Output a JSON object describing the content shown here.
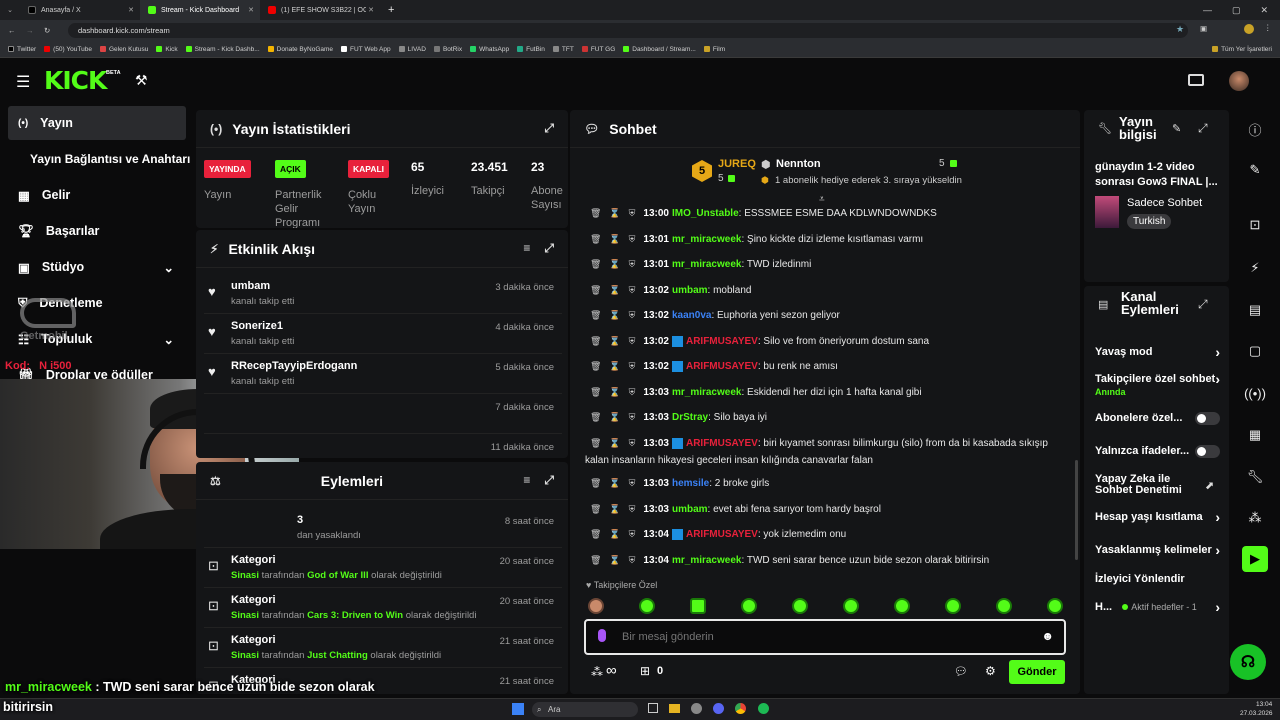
{
  "browser": {
    "tabs": [
      {
        "label": "Anasayfa / X"
      },
      {
        "label": "Stream - Kick Dashboard"
      },
      {
        "label": "(1) EFE SHOW S3B22 | OĞUZHA..."
      }
    ],
    "new_tab": "+",
    "url": "dashboard.kick.com/stream",
    "bookmarks": [
      "Twitter",
      "(50) YouTube",
      "Gelen Kutusu",
      "Kick",
      "Stream - Kick Dashb...",
      "Donate ByNoGame",
      "FUT Web App",
      "LIVAD",
      "BotRix",
      "WhatsApp",
      "FutBin",
      "TFT",
      "FUT GG",
      "Dashboard / Stream...",
      "Film"
    ],
    "bookmarks_right": "Tüm Yer İşaretleri"
  },
  "header": {
    "logo": "KICK",
    "beta": "BETA"
  },
  "sidebar": {
    "items": [
      {
        "label": "Yayın",
        "icon": "live-icon"
      },
      {
        "label": "Yayın Bağlantısı ve Anahtarı",
        "icon": ""
      },
      {
        "label": "Gelir",
        "icon": "revenue-icon"
      },
      {
        "label": "Başarılar",
        "icon": "trophy-icon"
      },
      {
        "label": "Stüdyo",
        "icon": "studio-icon"
      },
      {
        "label": "Denetleme",
        "icon": "shield-icon"
      },
      {
        "label": "Topluluk",
        "icon": "users-icon"
      },
      {
        "label": "Droplar ve ödüller",
        "icon": "gift-icon"
      }
    ]
  },
  "overlay": {
    "watermark": "Getmobil",
    "code_label": "Kod:",
    "code_value": "N   i500",
    "chat_line_user": "mr_miracweek",
    "chat_line_text": " : TWD seni sarar bence uzun bide sezon olarak",
    "chat_line_text2": "bitirirsin"
  },
  "stats": {
    "title": "Yayın İstatistikleri",
    "badges": [
      {
        "text": "YAYINDA",
        "label": "Yayın",
        "color": "#e8213b"
      },
      {
        "text": "AÇIK",
        "label": "Partnerlik Gelir Programı",
        "color": "#53fc18"
      },
      {
        "text": "KAPALI",
        "label": "Çoklu Yayın",
        "color": "#e8213b"
      }
    ],
    "numbers": [
      {
        "value": "65",
        "label": "İzleyici"
      },
      {
        "value": "23.451",
        "label": "Takipçi"
      },
      {
        "value": "23",
        "label": "Abone Sayısı"
      }
    ]
  },
  "activity": {
    "title": "Etkinlik Akışı",
    "items": [
      {
        "name": "umbam",
        "desc": "kanalı takip etti",
        "time": "3 dakika önce"
      },
      {
        "name": "Sonerize1",
        "desc": "kanalı takip etti",
        "time": "4 dakika önce"
      },
      {
        "name": "RRecepTayyipErdogann",
        "desc": "kanalı takip etti",
        "time": "5 dakika önce"
      },
      {
        "name": "",
        "desc": "",
        "time": "7 dakika önce"
      },
      {
        "name": "",
        "desc": "",
        "time": "11 dakika önce"
      }
    ]
  },
  "modactions": {
    "title": "Eylemleri",
    "items": [
      {
        "name": "3",
        "desc": "dan yasaklandı",
        "time": "8 saat önce"
      },
      {
        "name": "Kategori",
        "user": "Sinasi",
        "mid": " tarafından ",
        "game": "God of War III",
        "tail": " olarak değiştirildi",
        "time": "20 saat önce"
      },
      {
        "name": "Kategori",
        "user": "Sinasi",
        "mid": " tarafından ",
        "game": "Cars 3: Driven to Win",
        "tail": " olarak değiştirildi",
        "time": "20 saat önce"
      },
      {
        "name": "Kategori",
        "user": "Sinasi",
        "mid": " tarafından ",
        "game": "Just Chatting",
        "tail": " olarak değiştirildi",
        "time": "21 saat önce"
      },
      {
        "name": "Kategori",
        "time": "21 saat önce"
      }
    ]
  },
  "chat": {
    "title": "Sohbet",
    "pinned": {
      "user1": "JUREQ",
      "user1_count": "5",
      "user2": "Nennton",
      "user2_count": "5",
      "desc": "1 abonelik hediye ederek 3. sıraya yükseldin",
      "level": "5"
    },
    "messages": [
      {
        "time": "13:00",
        "user": "IMO_Unstable",
        "color": "#53fc18",
        "text": "ESSSMEE ESME DAA KDLWNDOWNDKS"
      },
      {
        "time": "13:01",
        "user": "mr_miracweek",
        "color": "#53fc18",
        "text": "Şino kickte dizi izleme kısıtlaması varmı"
      },
      {
        "time": "13:01",
        "user": "mr_miracweek",
        "color": "#53fc18",
        "text": "TWD izledinmi"
      },
      {
        "time": "13:02",
        "user": "umbam",
        "color": "#53fc18",
        "text": "mobland"
      },
      {
        "time": "13:02",
        "user": "kaan0va",
        "color": "#3b82f6",
        "text": "Euphoria yeni sezon geliyor"
      },
      {
        "time": "13:02",
        "user": "ARIFMUSAYEV",
        "color": "#e8213b",
        "text": "Silo ve from öneriyorum dostum sana"
      },
      {
        "time": "13:02",
        "user": "ARIFMUSAYEV",
        "color": "#e8213b",
        "text": "bu renk ne amısı"
      },
      {
        "time": "13:03",
        "user": "mr_miracweek",
        "color": "#53fc18",
        "text": "Eskidendi her dizi için 1 hafta kanal gibi"
      },
      {
        "time": "13:03",
        "user": "DrStray",
        "color": "#53fc18",
        "text": "Silo baya iyi"
      },
      {
        "time": "13:03",
        "user": "ARIFMUSAYEV",
        "color": "#e8213b",
        "text": "biri kıyamet sonrası bilimkurgu (silo) from da bi kasabada sıkışıp kalan insanların hikayesi geceleri insan kılığında canavarlar falan"
      },
      {
        "time": "13:03",
        "user": "hemsile",
        "color": "#3b82f6",
        "text": "2 broke girls"
      },
      {
        "time": "13:03",
        "user": "umbam",
        "color": "#53fc18",
        "text": "evet abi fena sarıyor tom hardy başrol"
      },
      {
        "time": "13:04",
        "user": "ARIFMUSAYEV",
        "color": "#e8213b",
        "text": "yok izlemedim onu"
      },
      {
        "time": "13:04",
        "user": "mr_miracweek",
        "color": "#53fc18",
        "text": "TWD seni sarar bence uzun bide sezon olarak bitirirsin"
      }
    ],
    "followers_only": "Takipçilere Özel",
    "placeholder": "Bir mesaj gönderin",
    "infinity": "∞",
    "points": "0",
    "send": "Gönder"
  },
  "streaminfo": {
    "title": "Yayın bilgisi",
    "stream_title": "günaydın 1-2 video sonrası Gow3 FINAL |...",
    "category": "Sadece Sohbet",
    "tag": "Turkish"
  },
  "channel": {
    "title": "Kanal Eylemleri",
    "items": [
      {
        "label": "Yavaş mod",
        "sub": ""
      },
      {
        "label": "Takipçilere özel sohbet",
        "sub": "Anında"
      },
      {
        "label": "Abonelere özel...",
        "sub": ""
      },
      {
        "label": "Yalnızca ifadeler...",
        "sub": ""
      },
      {
        "label": "Yapay Zeka ile Sohbet Denetimi",
        "sub": ""
      },
      {
        "label": "Hesap yaşı kısıtlama",
        "sub": ""
      },
      {
        "label": "Yasaklanmış kelimeler",
        "sub": ""
      },
      {
        "label": "İzleyici Yönlendir",
        "sub": ""
      },
      {
        "label": "H...",
        "sub": "Aktif hedefler - 1"
      }
    ]
  },
  "taskbar": {
    "search": "Ara",
    "time": "13:04",
    "date": "27.03.2026"
  }
}
